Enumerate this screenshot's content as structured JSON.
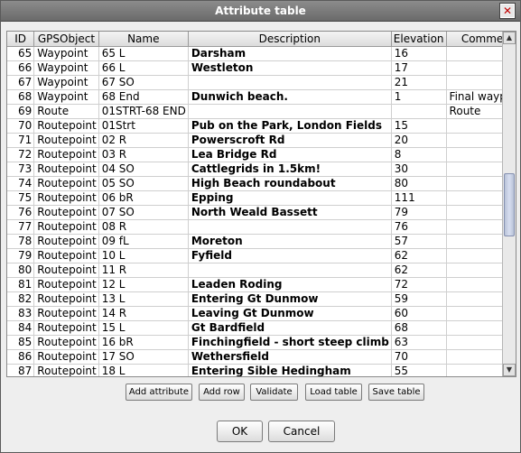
{
  "window": {
    "title": "Attribute table",
    "close_glyph": "✕"
  },
  "table": {
    "columns": [
      "ID",
      "GPSObject",
      "Name",
      "Description",
      "Elevation",
      "Comment"
    ],
    "rows": [
      [
        "65",
        "Waypoint",
        "65 L",
        "Darsham",
        "16",
        ""
      ],
      [
        "66",
        "Waypoint",
        "66 L",
        "Westleton",
        "17",
        ""
      ],
      [
        "67",
        "Waypoint",
        "67 SO",
        "",
        "21",
        ""
      ],
      [
        "68",
        "Waypoint",
        "68 End",
        "Dunwich beach.",
        "1",
        "Final waypoint"
      ],
      [
        "69",
        "Route",
        "01STRT-68 END",
        "",
        "",
        "Route"
      ],
      [
        "70",
        "Routepoint",
        "01Strt",
        "Pub on the Park, London Fields",
        "15",
        ""
      ],
      [
        "71",
        "Routepoint",
        "02 R",
        "Powerscroft Rd",
        "20",
        ""
      ],
      [
        "72",
        "Routepoint",
        "03 R",
        "Lea Bridge Rd",
        "8",
        ""
      ],
      [
        "73",
        "Routepoint",
        "04 SO",
        "Cattlegrids in 1.5km!",
        "30",
        ""
      ],
      [
        "74",
        "Routepoint",
        "05 SO",
        "High Beach roundabout",
        "80",
        ""
      ],
      [
        "75",
        "Routepoint",
        "06 bR",
        "Epping",
        "111",
        ""
      ],
      [
        "76",
        "Routepoint",
        "07 SO",
        "North Weald Bassett",
        "79",
        ""
      ],
      [
        "77",
        "Routepoint",
        "08 R",
        "",
        "76",
        ""
      ],
      [
        "78",
        "Routepoint",
        "09 fL",
        "Moreton",
        "57",
        ""
      ],
      [
        "79",
        "Routepoint",
        "10 L",
        "Fyfield",
        "62",
        ""
      ],
      [
        "80",
        "Routepoint",
        "11 R",
        "",
        "62",
        ""
      ],
      [
        "81",
        "Routepoint",
        "12 L",
        "Leaden Roding",
        "72",
        ""
      ],
      [
        "82",
        "Routepoint",
        "13 L",
        "Entering Gt Dunmow",
        "59",
        ""
      ],
      [
        "83",
        "Routepoint",
        "14 R",
        "Leaving Gt Dunmow",
        "60",
        ""
      ],
      [
        "84",
        "Routepoint",
        "15 L",
        "Gt Bardfield",
        "68",
        ""
      ],
      [
        "85",
        "Routepoint",
        "16 bR",
        "Finchingfield - short steep climb",
        "63",
        ""
      ],
      [
        "86",
        "Routepoint",
        "17 SO",
        "Wethersfield",
        "70",
        ""
      ],
      [
        "87",
        "Routepoint",
        "18 L",
        "Entering Sible Hedingham",
        "55",
        ""
      ]
    ]
  },
  "scrollbar": {
    "up_icon": "up-arrow-icon",
    "down_icon": "down-arrow-icon",
    "up_glyph": "▲",
    "down_glyph": "▼"
  },
  "actions": {
    "add_attribute": "Add attribute",
    "add_row": "Add row",
    "validate": "Validate",
    "load_table": "Load table",
    "save_table": "Save table"
  },
  "dialog": {
    "ok": "OK",
    "cancel": "Cancel"
  }
}
